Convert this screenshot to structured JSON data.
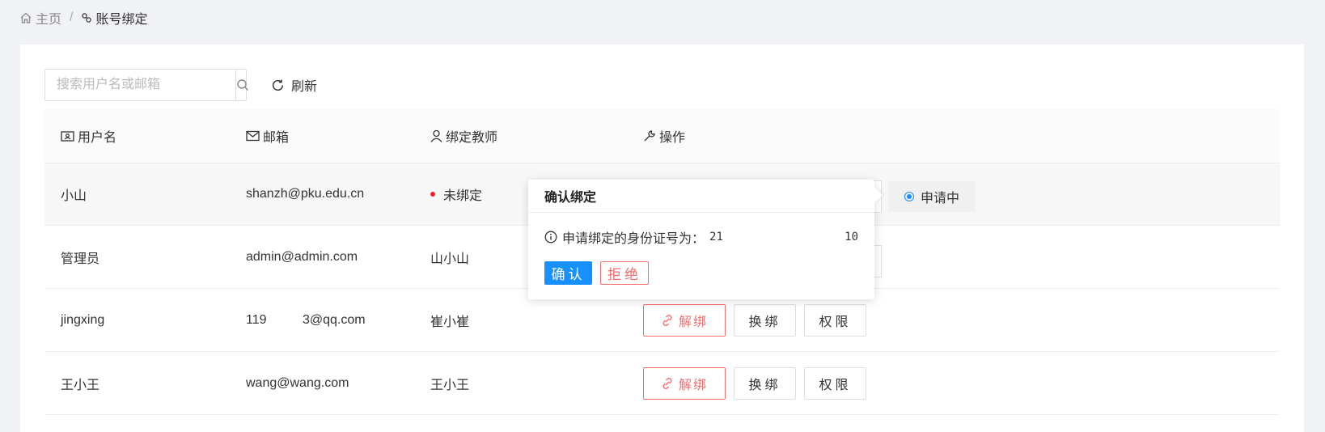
{
  "breadcrumb": {
    "home": "主页",
    "separator": "/",
    "current": "账号绑定"
  },
  "toolbar": {
    "search_placeholder": "搜索用户名或邮箱",
    "refresh_label": "刷新"
  },
  "table": {
    "headers": {
      "username": "用户名",
      "email": "邮箱",
      "teacher": "绑定教师",
      "actions": "操作"
    },
    "rows": [
      {
        "username": "小山",
        "email": "shanzh@pku.edu.cn",
        "teacher": "未绑定",
        "status": "申请中"
      },
      {
        "username": "管理员",
        "email": "admin@admin.com",
        "teacher": "山小山"
      },
      {
        "username": "jingxing",
        "email": "119          3@qq.com",
        "teacher": "崔小崔"
      },
      {
        "username": "王小王",
        "email": "wang@wang.com",
        "teacher": "王小王"
      }
    ],
    "buttons": {
      "unbind": "解绑",
      "swap": "换绑",
      "permission": "权限"
    }
  },
  "popover": {
    "title": "确认绑定",
    "message": "申请绑定的身份证号为：",
    "id_prefix": "21",
    "id_suffix": "10",
    "confirm": "确认",
    "reject": "拒绝"
  },
  "colors": {
    "primary": "#1890ff",
    "danger": "#f56c6c",
    "unbound_dot": "#f5222d"
  }
}
